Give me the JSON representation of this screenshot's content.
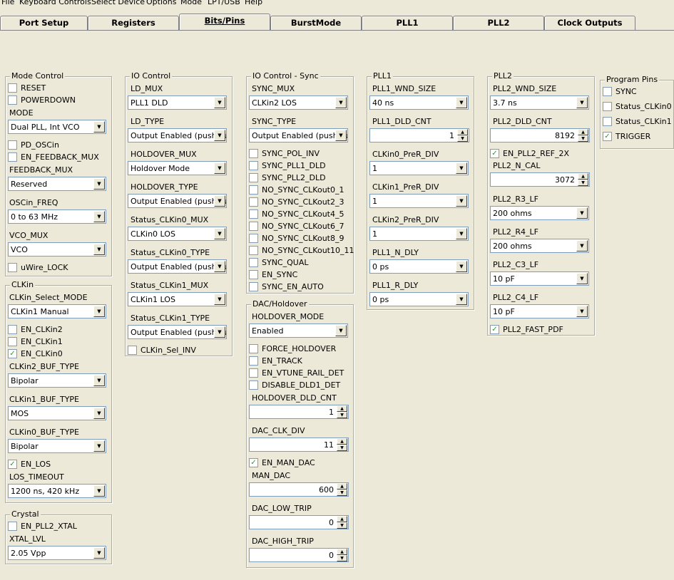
{
  "menu": [
    "File",
    "Keyboard Controls",
    "Select Device",
    "Options",
    "Mode",
    "LPT/USB",
    "Help"
  ],
  "tabs": [
    "Port Setup",
    "Registers",
    "Bits/Pins",
    "BurstMode",
    "PLL1",
    "PLL2",
    "Clock Outputs"
  ],
  "mode_control": {
    "title": "Mode Control",
    "reset": "RESET",
    "powerdown": "POWERDOWN",
    "mode_label": "MODE",
    "mode_value": "Dual PLL, Int VCO",
    "pd_oscin": "PD_OSCin",
    "en_feedback_mux": "EN_FEEDBACK_MUX",
    "feedback_mux_label": "FEEDBACK_MUX",
    "feedback_mux_value": "Reserved",
    "oscin_freq_label": "OSCin_FREQ",
    "oscin_freq_value": "0 to 63 MHz",
    "vco_mux_label": "VCO_MUX",
    "vco_mux_value": "VCO",
    "uwire_lock": "uWire_LOCK"
  },
  "clkin": {
    "title": "CLKin",
    "select_mode_label": "CLKin_Select_MODE",
    "select_mode_value": "CLKin1 Manual",
    "en_clkin2": "EN_CLKin2",
    "en_clkin1": "EN_CLKin1",
    "en_clkin0": "EN_CLKin0",
    "clkin2_buf_label": "CLKin2_BUF_TYPE",
    "clkin2_buf_value": "Bipolar",
    "clkin1_buf_label": "CLKin1_BUF_TYPE",
    "clkin1_buf_value": "MOS",
    "clkin0_buf_label": "CLKin0_BUF_TYPE",
    "clkin0_buf_value": "Bipolar",
    "en_los": "EN_LOS",
    "los_timeout_label": "LOS_TIMEOUT",
    "los_timeout_value": "1200 ns, 420 kHz"
  },
  "crystal": {
    "title": "Crystal",
    "en_pll2_xtal": "EN_PLL2_XTAL",
    "xtal_lvl_label": "XTAL_LVL",
    "xtal_lvl_value": "2.05 Vpp"
  },
  "io_control": {
    "title": "IO Control",
    "ld_mux_label": "LD_MUX",
    "ld_mux_value": "PLL1 DLD",
    "ld_type_label": "LD_TYPE",
    "ld_type_value": "Output Enabled (push-pull)",
    "holdover_mux_label": "HOLDOVER_MUX",
    "holdover_mux_value": "Holdover Mode",
    "holdover_type_label": "HOLDOVER_TYPE",
    "holdover_type_value": "Output Enabled (push-pull)",
    "status_clkin0_mux_label": "Status_CLKin0_MUX",
    "status_clkin0_mux_value": "CLKin0 LOS",
    "status_clkin0_type_label": "Status_CLKin0_TYPE",
    "status_clkin0_type_value": "Output Enabled (push-pull)",
    "status_clkin1_mux_label": "Status_CLKin1_MUX",
    "status_clkin1_mux_value": "CLKin1 LOS",
    "status_clkin1_type_label": "Status_CLKin1_TYPE",
    "status_clkin1_type_value": "Output Enabled (push-pull)",
    "clkin_sel_inv": "CLKin_Sel_INV"
  },
  "io_sync": {
    "title": "IO Control - Sync",
    "sync_mux_label": "SYNC_MUX",
    "sync_mux_value": "CLKin2 LOS",
    "sync_type_label": "SYNC_TYPE",
    "sync_type_value": "Output Enabled (push-pull)",
    "checks": [
      "SYNC_POL_INV",
      "SYNC_PLL1_DLD",
      "SYNC_PLL2_DLD",
      "NO_SYNC_CLKout0_1",
      "NO_SYNC_CLKout2_3",
      "NO_SYNC_CLKout4_5",
      "NO_SYNC_CLKout6_7",
      "NO_SYNC_CLKout8_9",
      "NO_SYNC_CLKout10_11",
      "SYNC_QUAL",
      "EN_SYNC",
      "SYNC_EN_AUTO"
    ]
  },
  "dac": {
    "title": "DAC/Holdover",
    "holdover_mode_label": "HOLDOVER_MODE",
    "holdover_mode_value": "Enabled",
    "force_holdover": "FORCE_HOLDOVER",
    "en_track": "EN_TRACK",
    "en_vtune": "EN_VTUNE_RAIL_DET",
    "disable_dld1": "DISABLE_DLD1_DET",
    "holdover_dld_cnt_label": "HOLDOVER_DLD_CNT",
    "holdover_dld_cnt_value": "1",
    "dac_clk_div_label": "DAC_CLK_DIV",
    "dac_clk_div_value": "11",
    "en_man_dac": "EN_MAN_DAC",
    "man_dac_label": "MAN_DAC",
    "man_dac_value": "600",
    "dac_low_trip_label": "DAC_LOW_TRIP",
    "dac_low_trip_value": "0",
    "dac_high_trip_label": "DAC_HIGH_TRIP",
    "dac_high_trip_value": "0"
  },
  "pll1": {
    "title": "PLL1",
    "wnd_size_label": "PLL1_WND_SIZE",
    "wnd_size_value": "40 ns",
    "dld_cnt_label": "PLL1_DLD_CNT",
    "dld_cnt_value": "1",
    "clkin0_prer_label": "CLKin0_PreR_DIV",
    "clkin0_prer_value": "1",
    "clkin1_prer_label": "CLKin1_PreR_DIV",
    "clkin1_prer_value": "1",
    "clkin2_prer_label": "CLKin2_PreR_DIV",
    "clkin2_prer_value": "1",
    "n_dly_label": "PLL1_N_DLY",
    "n_dly_value": "0 ps",
    "r_dly_label": "PLL1_R_DLY",
    "r_dly_value": "0 ps"
  },
  "pll2": {
    "title": "PLL2",
    "wnd_size_label": "PLL2_WND_SIZE",
    "wnd_size_value": "3.7 ns",
    "dld_cnt_label": "PLL2_DLD_CNT",
    "dld_cnt_value": "8192",
    "en_ref_2x": "EN_PLL2_REF_2X",
    "n_cal_label": "PLL2_N_CAL",
    "n_cal_value": "3072",
    "r3_label": "PLL2_R3_LF",
    "r3_value": "200 ohms",
    "r4_label": "PLL2_R4_LF",
    "r4_value": "200 ohms",
    "c3_label": "PLL2_C3_LF",
    "c3_value": "10 pF",
    "c4_label": "PLL2_C4_LF",
    "c4_value": "10 pF",
    "fast_pdf": "PLL2_FAST_PDF"
  },
  "program_pins": {
    "title": "Program Pins",
    "sync": "SYNC",
    "status_clkin0": "Status_CLKin0",
    "status_clkin1": "Status_CLKin1",
    "trigger": "TRIGGER"
  },
  "icons": {
    "check": "✓",
    "arrow": "▼",
    "up": "▲",
    "down": "▼"
  }
}
